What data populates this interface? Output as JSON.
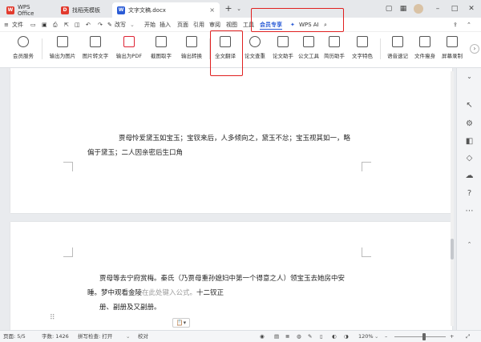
{
  "colors": {
    "accent": "#2b5cd6",
    "highlight": "#e02020",
    "wps_logo": "#e23b2e",
    "doc_icon": "#2b5cd6"
  },
  "tabs": [
    {
      "label": "WPS Office",
      "icon": "wps-logo-icon"
    },
    {
      "label": "找稻壳模板",
      "icon": "docer-icon"
    },
    {
      "label": "文字文稿.docx",
      "icon": "document-icon"
    }
  ],
  "menu": {
    "file": "文件",
    "items": [
      "开始",
      "插入",
      "页面",
      "引用",
      "审阅",
      "视图",
      "工具",
      "会员专享"
    ],
    "wps_ai": "WPS AI",
    "modify": "改写"
  },
  "ribbon": {
    "items": [
      "会员服务",
      "输出为图片",
      "图片转文字",
      "输出为PDF",
      "截图取字",
      "输出转换",
      "全文翻译",
      "论文查重",
      "论文助手",
      "公文工具",
      "简历助手",
      "文字特色",
      "语音速记",
      "文件瘦身",
      "屏幕录制"
    ]
  },
  "doc": {
    "p1_line1": "贾母怜爱黛玉如宝玉；宝钗来后，人多倾向之，黛玉不忿；宝玉视其如一，略",
    "p1_line2": "偏于黛玉；二人因亲密后生口角",
    "p2_line1": "贾母等去宁府赏梅。秦氏（乃贾母重孙媳妇中第一个得意之人）领宝玉去她房中安",
    "p2_line2_a": "睡。梦中观看金陵",
    "p2_line2_hint": "在此处键入公式。",
    "p2_line2_b": "十二钗正",
    "p2_line3": "册、副册及又副册。"
  },
  "status": {
    "page": "页面: 5/5",
    "words": "字数: 1426",
    "spell": "拼写检查: 打开",
    "proof": "校对",
    "zoom": "120%"
  }
}
